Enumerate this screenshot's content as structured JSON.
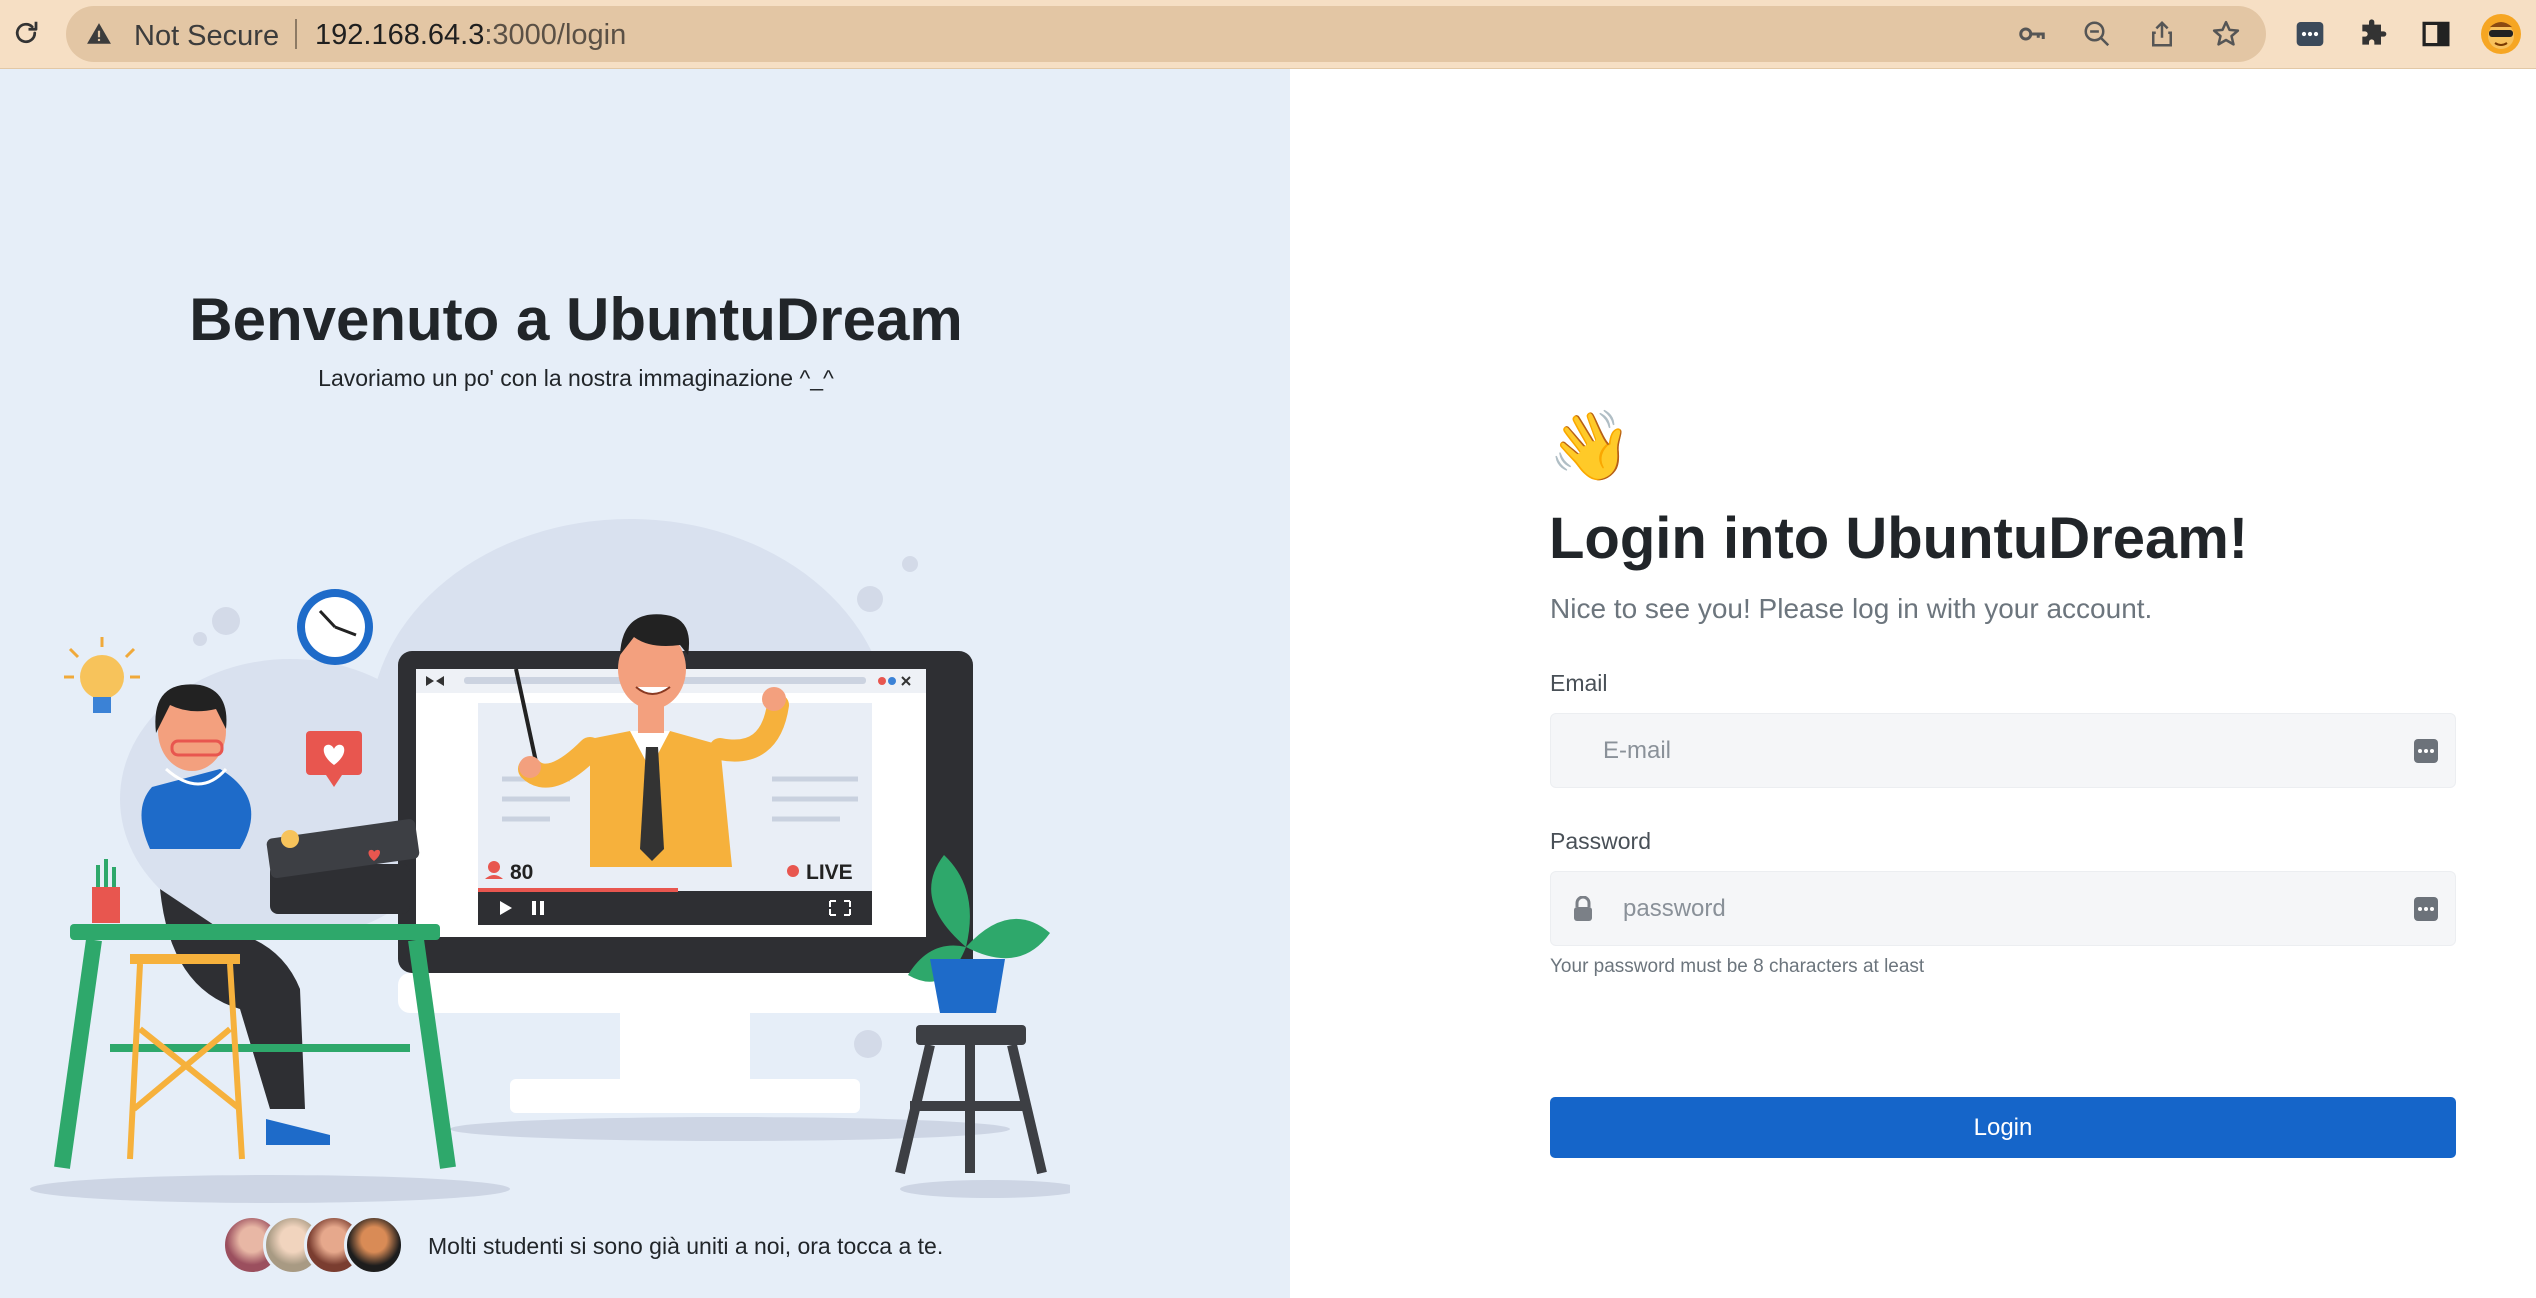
{
  "browser": {
    "security_label": "Not Secure",
    "url_host": "192.168.64.3",
    "url_path": ":3000/login",
    "icons": [
      "reload-icon",
      "warning-icon",
      "key-icon",
      "zoom-out-icon",
      "share-icon",
      "star-icon",
      "password-manager-icon",
      "extensions-icon",
      "sidepanel-icon",
      "profile-avatar"
    ]
  },
  "left": {
    "welcome_title": "Benvenuto a UbuntuDream",
    "welcome_subtitle": "Lavoriamo un po' con la nostra immaginazione ^_^",
    "illustration": {
      "viewer_count": "80",
      "live_label": "LIVE"
    },
    "students_text": "Molti studenti si sono già uniti a noi, ora tocca a te."
  },
  "login": {
    "wave_emoji": "👋",
    "title": "Login into UbuntuDream!",
    "subtitle": "Nice to see you! Please log in with your account.",
    "email_label": "Email",
    "email_placeholder": "E-mail",
    "email_value": "",
    "password_label": "Password",
    "password_placeholder": "password",
    "password_value": "",
    "password_hint": "Your password must be 8 characters at least",
    "submit_label": "Login"
  },
  "colors": {
    "toolbar": "#f6dfc4",
    "left_panel": "#e6eef8",
    "primary_button": "#1565c9"
  }
}
